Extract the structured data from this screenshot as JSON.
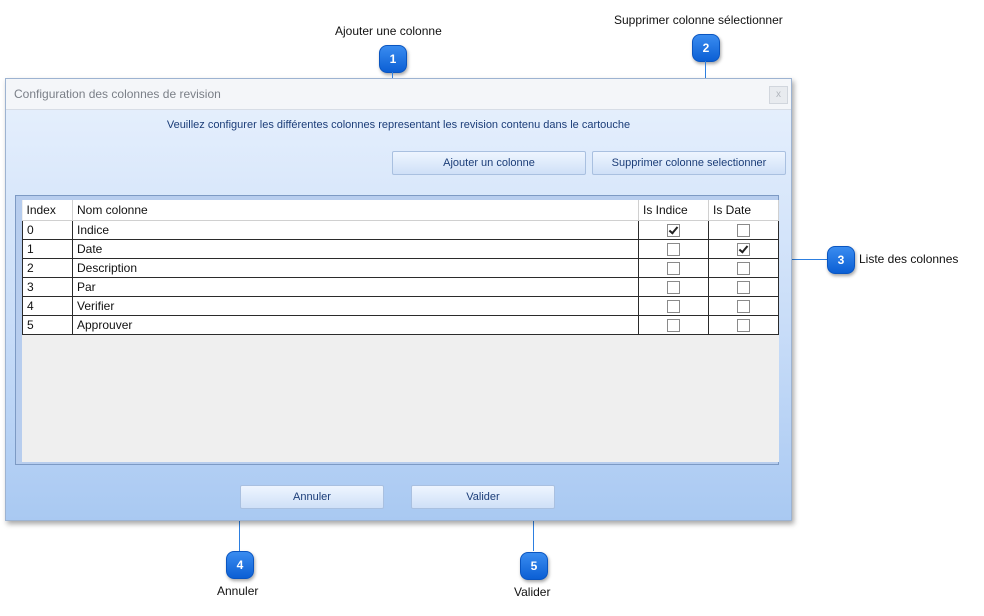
{
  "callouts": [
    {
      "number": "1",
      "label": "Ajouter une colonne"
    },
    {
      "number": "2",
      "label": "Supprimer colonne sélectionner"
    },
    {
      "number": "3",
      "label": "Liste des colonnes"
    },
    {
      "number": "4",
      "label": "Annuler"
    },
    {
      "number": "5",
      "label": "Valider"
    }
  ],
  "dialog": {
    "title": "Configuration des colonnes de revision",
    "close_label": "x",
    "instructions": "Veuillez configurer les différentes colonnes representant les revision contenu dans le cartouche",
    "add_button": "Ajouter un colonne",
    "remove_button": "Supprimer colonne selectionner",
    "cancel_button": "Annuler",
    "validate_button": "Valider"
  },
  "grid": {
    "headers": [
      "Index",
      "Nom colonne",
      "Is Indice",
      "Is Date"
    ],
    "rows": [
      {
        "index": "0",
        "name": "Indice",
        "is_indice": true,
        "is_date": false
      },
      {
        "index": "1",
        "name": "Date",
        "is_indice": false,
        "is_date": true
      },
      {
        "index": "2",
        "name": "Description",
        "is_indice": false,
        "is_date": false
      },
      {
        "index": "3",
        "name": "Par",
        "is_indice": false,
        "is_date": false
      },
      {
        "index": "4",
        "name": "Verifier",
        "is_indice": false,
        "is_date": false
      },
      {
        "index": "5",
        "name": "Approuver",
        "is_indice": false,
        "is_date": false
      }
    ]
  },
  "colors": {
    "badge": "#0b5fd4",
    "connector": "#2d7fe0",
    "dialog_text": "#1b3d78"
  }
}
